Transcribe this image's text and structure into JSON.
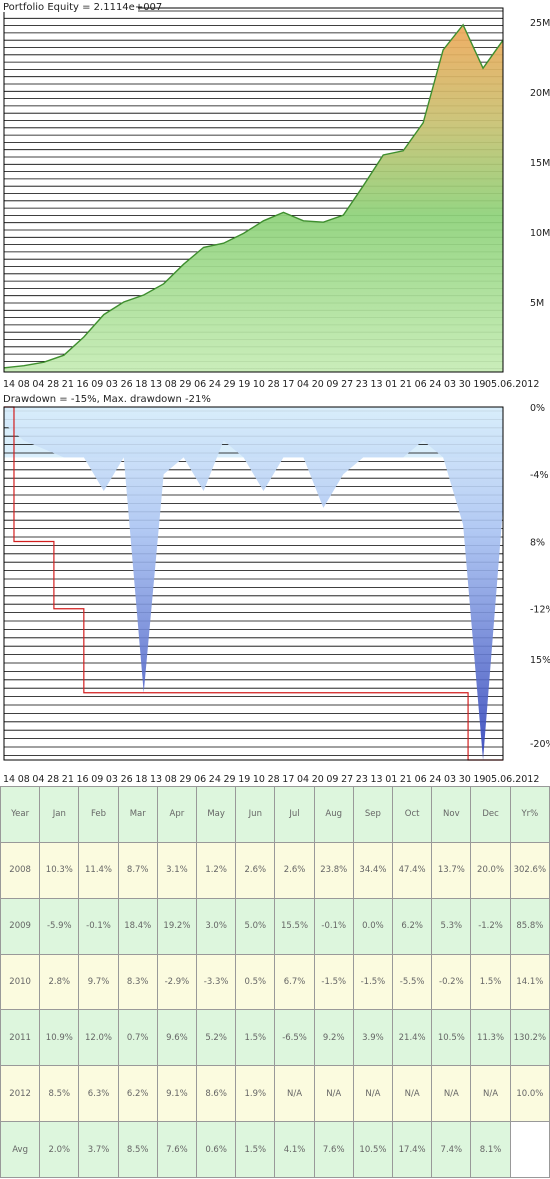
{
  "colors": {
    "equity_green": "#8ed27a",
    "equity_orange": "#eea95a",
    "equity_line": "#3f8f2f",
    "drawdown_blue": "#6b85e6",
    "drawdown_light": "#d9eefb",
    "maxdd_red": "#d21f1f",
    "table_row_a": "#ddf6dd",
    "table_row_b": "#fbfbdf"
  },
  "chart_data": [
    {
      "type": "area",
      "title": "Portfolio Equity = 2.1114e+007",
      "y_tick_labels": [
        "5M",
        "10M",
        "15M",
        "20M",
        "25M"
      ],
      "x_tick_labels": [
        "14",
        "08",
        "04",
        "28",
        "21",
        "16",
        "09",
        "03",
        "26",
        "18",
        "13",
        "08",
        "29",
        "06",
        "24",
        "29",
        "19",
        "10",
        "28",
        "17",
        "04",
        "20",
        "09",
        "27",
        "23",
        "13",
        "01",
        "21",
        "06",
        "24",
        "03",
        "30",
        "19",
        "05.06.2012"
      ],
      "ylim": [
        0,
        26000000
      ],
      "x": [
        0,
        4,
        8,
        12,
        16,
        20,
        24,
        28,
        32,
        36,
        40,
        44,
        48,
        52,
        56,
        60,
        64,
        68,
        72,
        76,
        80,
        84,
        88,
        92,
        96,
        100
      ],
      "values": [
        300000,
        450000,
        700000,
        1200000,
        2500000,
        4100000,
        5000000,
        5500000,
        6300000,
        7700000,
        8900000,
        9200000,
        9900000,
        10800000,
        11400000,
        10800000,
        10700000,
        11200000,
        13300000,
        15500000,
        15800000,
        17800000,
        23000000,
        24800000,
        21700000,
        23700000
      ],
      "grid": true
    },
    {
      "type": "area",
      "title": "Drawdown = -15%, Max. drawdown -21%",
      "y_tick_labels": [
        "0%",
        "-4%",
        "8%",
        "-12%",
        "15%",
        "-20%"
      ],
      "x_tick_labels": [
        "14",
        "08",
        "04",
        "28",
        "21",
        "16",
        "09",
        "03",
        "26",
        "18",
        "13",
        "08",
        "29",
        "06",
        "24",
        "29",
        "19",
        "10",
        "28",
        "17",
        "04",
        "20",
        "09",
        "27",
        "23",
        "13",
        "01",
        "21",
        "06",
        "24",
        "03",
        "30",
        "19",
        "05.06.2012"
      ],
      "ylim": [
        -21,
        0
      ],
      "x": [
        0,
        4,
        8,
        12,
        16,
        20,
        24,
        28,
        32,
        36,
        40,
        44,
        48,
        52,
        56,
        60,
        64,
        68,
        72,
        76,
        80,
        84,
        88,
        92,
        96,
        100
      ],
      "values": [
        -1,
        -2,
        -2.5,
        -3,
        -3,
        -5,
        -3,
        -17,
        -4,
        -3,
        -5,
        -2,
        -3,
        -5,
        -3,
        -3,
        -6,
        -4,
        -3,
        -3,
        -3,
        -2,
        -3,
        -7,
        -21,
        -6
      ],
      "max_drawdown_x": [
        0,
        2,
        2,
        10,
        10,
        16,
        16,
        23,
        23,
        93,
        93,
        100
      ],
      "max_drawdown_values": [
        0,
        0,
        -8,
        -8,
        -12,
        -12,
        -17,
        -17,
        -17,
        -17,
        -21,
        -21
      ],
      "grid": true
    },
    {
      "type": "table",
      "header": [
        "Year",
        "Jan",
        "Feb",
        "Mar",
        "Apr",
        "May",
        "Jun",
        "Jul",
        "Aug",
        "Sep",
        "Oct",
        "Nov",
        "Dec",
        "Yr%"
      ],
      "rows": [
        [
          "2008",
          "10.3%",
          "11.4%",
          "8.7%",
          "3.1%",
          "1.2%",
          "2.6%",
          "2.6%",
          "23.8%",
          "34.4%",
          "47.4%",
          "13.7%",
          "20.0%",
          "302.6%"
        ],
        [
          "2009",
          "-5.9%",
          "-0.1%",
          "18.4%",
          "19.2%",
          "3.0%",
          "5.0%",
          "15.5%",
          "-0.1%",
          "0.0%",
          "6.2%",
          "5.3%",
          "-1.2%",
          "85.8%"
        ],
        [
          "2010",
          "2.8%",
          "9.7%",
          "8.3%",
          "-2.9%",
          "-3.3%",
          "0.5%",
          "6.7%",
          "-1.5%",
          "-1.5%",
          "-5.5%",
          "-0.2%",
          "1.5%",
          "14.1%"
        ],
        [
          "2011",
          "10.9%",
          "12.0%",
          "0.7%",
          "9.6%",
          "5.2%",
          "1.5%",
          "-6.5%",
          "9.2%",
          "3.9%",
          "21.4%",
          "10.5%",
          "11.3%",
          "130.2%"
        ],
        [
          "2012",
          "8.5%",
          "6.3%",
          "6.2%",
          "9.1%",
          "8.6%",
          "1.9%",
          "N/A",
          "N/A",
          "N/A",
          "N/A",
          "N/A",
          "N/A",
          "10.0%"
        ],
        [
          "Avg",
          "2.0%",
          "3.7%",
          "8.5%",
          "7.6%",
          "0.6%",
          "1.5%",
          "4.1%",
          "7.6%",
          "10.5%",
          "17.4%",
          "7.4%",
          "8.1%",
          ""
        ]
      ]
    }
  ]
}
